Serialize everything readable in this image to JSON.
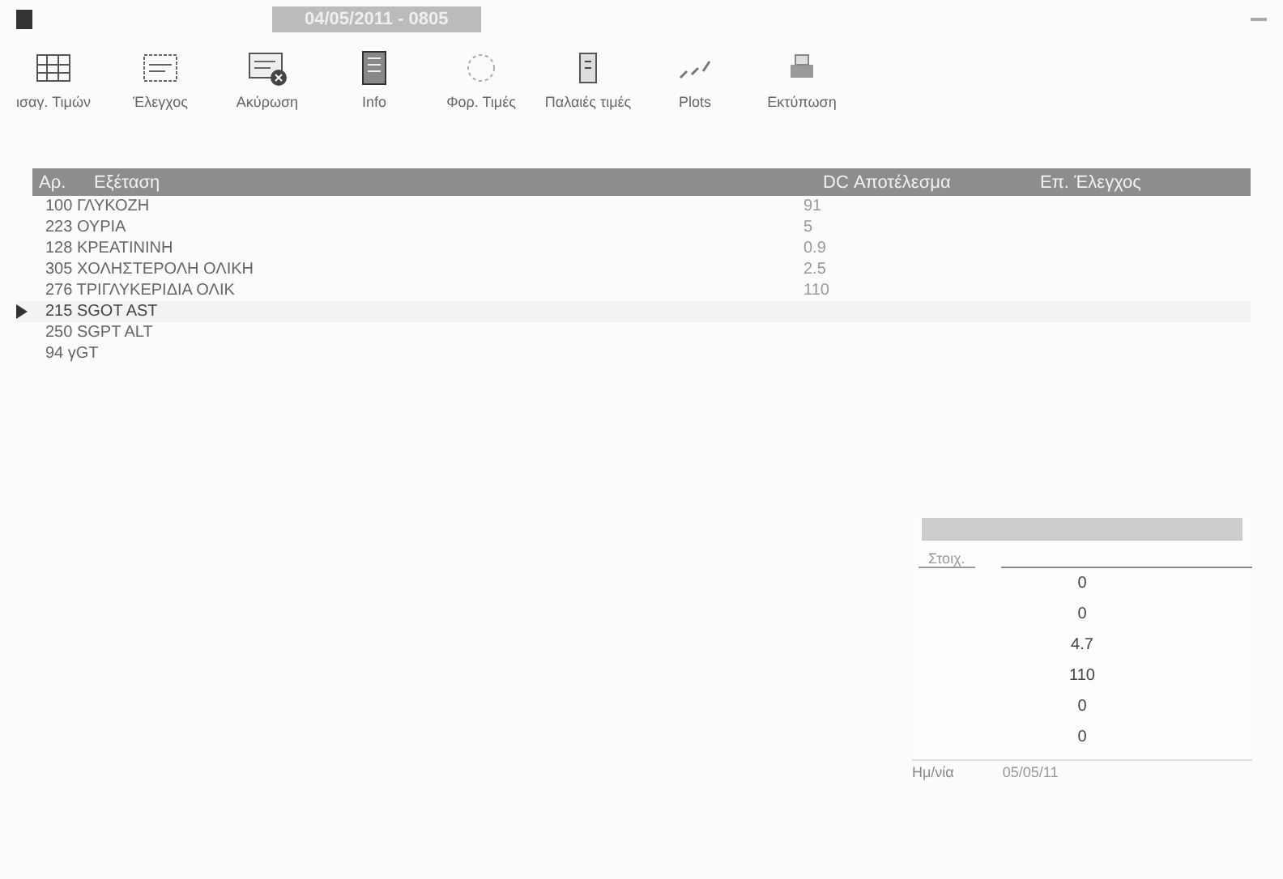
{
  "window": {
    "title": "04/05/2011 - 0805"
  },
  "toolbar": [
    {
      "label": "ισαγ. Τιμών",
      "kind": "grid"
    },
    {
      "label": "Έλεγχος",
      "kind": "form"
    },
    {
      "label": "Ακύρωση",
      "kind": "cancel"
    },
    {
      "label": "Info",
      "kind": "book"
    },
    {
      "label": "Φορ. Τιμές",
      "kind": "circle"
    },
    {
      "label": "Παλαιές τιμές",
      "kind": "file"
    },
    {
      "label": "Plots",
      "kind": "plot"
    },
    {
      "label": "Εκτύπωση",
      "kind": "print"
    }
  ],
  "table": {
    "columns": [
      "Αρ.",
      "Εξέταση",
      "DC Αποτέλεσμα",
      "Επ. Έλεγχος"
    ],
    "rows": [
      {
        "number": "100",
        "name": "ΓΛΥΚΟΖΗ",
        "result": "91",
        "selected": false
      },
      {
        "number": "223",
        "name": "ΟΥΡΙΑ",
        "result": "5",
        "selected": false
      },
      {
        "number": "128",
        "name": "ΚΡΕΑΤΙΝΙΝΗ",
        "result": "0.9",
        "selected": false
      },
      {
        "number": "305",
        "name": "ΧΟΛΗΣΤΕΡΟΛΗ ΟΛΙΚΗ",
        "result": "2.5",
        "selected": false
      },
      {
        "number": "276",
        "name": "ΤΡΙΓΛΥΚΕΡΙΔΙΑ ΟΛΙΚ",
        "result": "110",
        "selected": false
      },
      {
        "number": "215",
        "name": "SGOT AST",
        "result": "",
        "selected": true
      },
      {
        "number": "250",
        "name": "SGPT ALT",
        "result": "",
        "selected": false
      },
      {
        "number": "94",
        "name": "γGT",
        "result": "",
        "selected": false
      }
    ]
  },
  "panel": {
    "tab": "Στοιχ.",
    "values": [
      "0",
      "0",
      "4.7",
      "110",
      "0",
      "0"
    ],
    "date_label": "Ημ/νία",
    "date": "05/05/11"
  }
}
